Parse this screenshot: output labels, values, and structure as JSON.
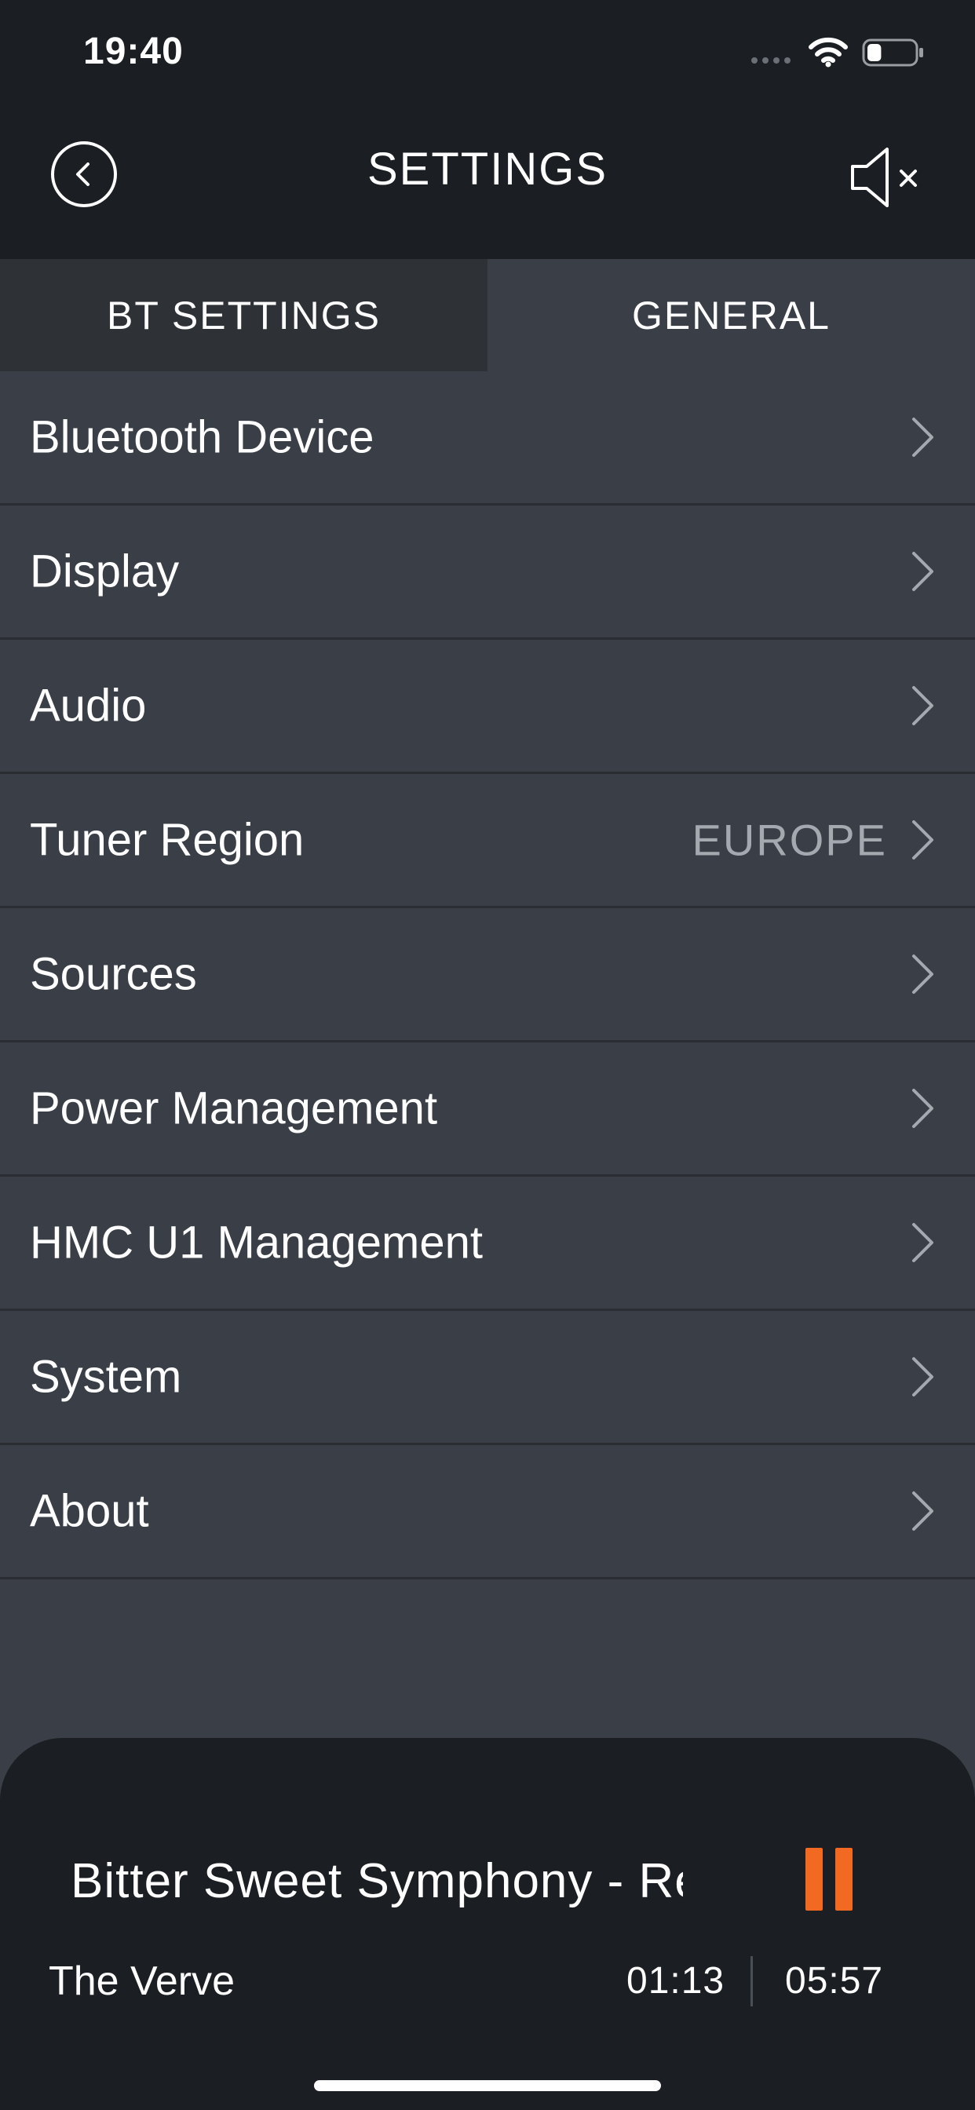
{
  "status_bar": {
    "time": "19:40",
    "icons": [
      "signal-icon",
      "wifi-icon",
      "battery-icon"
    ],
    "battery_level": 0.3
  },
  "header": {
    "title": "SETTINGS",
    "back_icon": "chevron-left-circle-icon",
    "mute_icon": "speaker-muted-icon"
  },
  "tabs": [
    {
      "label": "BT SETTINGS",
      "active": false
    },
    {
      "label": "GENERAL",
      "active": true
    }
  ],
  "settings": {
    "items": [
      {
        "label": "Bluetooth Device",
        "value": ""
      },
      {
        "label": "Display",
        "value": ""
      },
      {
        "label": "Audio",
        "value": ""
      },
      {
        "label": "Tuner Region",
        "value": "EUROPE"
      },
      {
        "label": "Sources",
        "value": ""
      },
      {
        "label": "Power Management",
        "value": ""
      },
      {
        "label": "HMC U1 Management",
        "value": ""
      },
      {
        "label": "System",
        "value": ""
      },
      {
        "label": "About",
        "value": ""
      }
    ]
  },
  "now_playing": {
    "title": "Bitter Sweet Symphony - Remastered",
    "artist": "The Verve",
    "elapsed": "01:13",
    "total": "05:57",
    "pause_icon": "pause-icon"
  },
  "colors": {
    "background": "#3a3f47",
    "bar": "#1b1e22",
    "tab_inactive": "#2e3237",
    "accent": "#f26a21",
    "muted_text": "#a4a9af"
  }
}
